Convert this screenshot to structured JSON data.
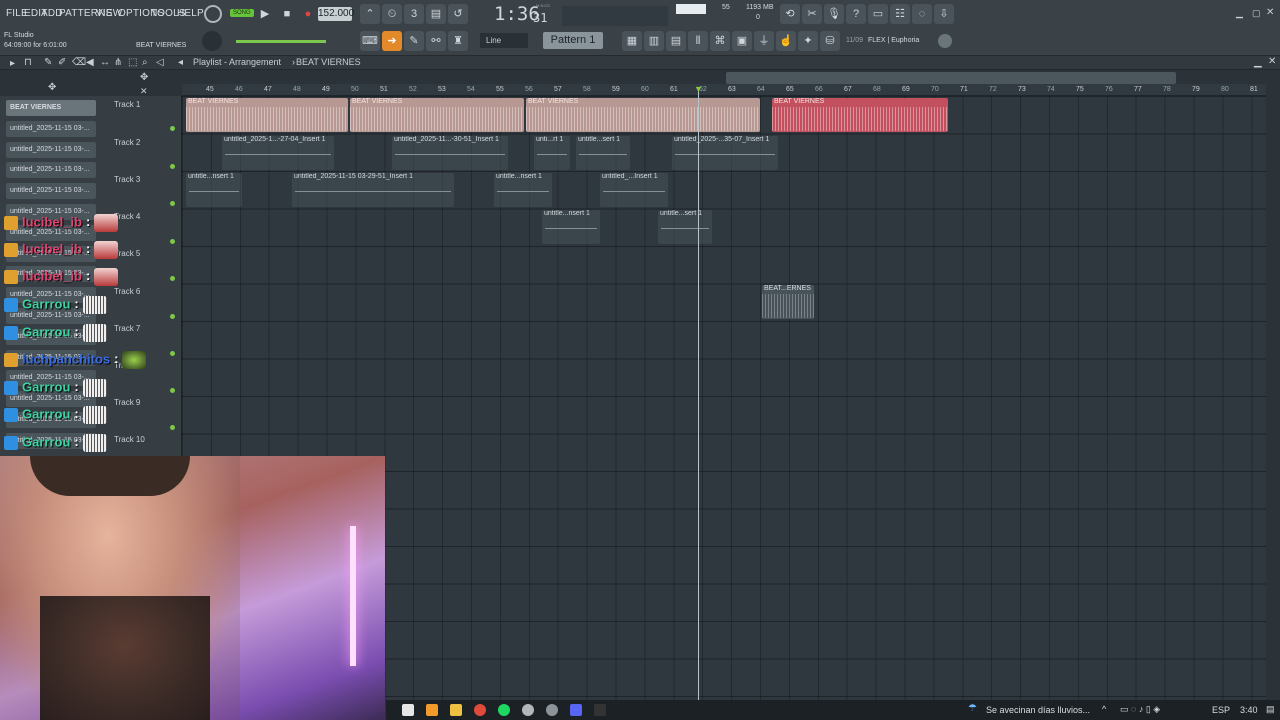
{
  "menu": [
    "FILE",
    "EDIT",
    "ADD",
    "PATTERNS",
    "VIEW",
    "OPTIONS",
    "TOOLS",
    "HELP"
  ],
  "transport": {
    "mode": "SONG",
    "tempo": "152.000",
    "time": "1:36",
    "time_sub": "31",
    "time_unit": "M:S:CS"
  },
  "status": {
    "app": "FL Studio",
    "position": "64:09:00 for 6:01:00",
    "current": "BEAT VIERNES"
  },
  "meters": {
    "cpu": "55",
    "memory": "1193 MB",
    "voices": "0"
  },
  "snap": "Line",
  "pattern": "Pattern 1",
  "news": {
    "date": "11/09",
    "text": "FLEX | Euphoria"
  },
  "playlist": {
    "title": "Playlist - Arrangement",
    "current": "BEAT VIERNES"
  },
  "ruler_ticks": [
    "45",
    "47",
    "49",
    "51",
    "53",
    "55",
    "57",
    "59",
    "61",
    "63",
    "65",
    "67",
    "69",
    "71",
    "73",
    "75",
    "77",
    "79",
    "81",
    "46",
    "48",
    "50",
    "52",
    "54",
    "56",
    "58",
    "60",
    "62",
    "64",
    "66",
    "68",
    "70",
    "72",
    "74",
    "76",
    "78",
    "80"
  ],
  "tracks": [
    "Track 1",
    "Track 2",
    "Track 3",
    "Track 4",
    "Track 5",
    "Track 6",
    "Track 7",
    "Track 8",
    "Track 9",
    "Track 10"
  ],
  "picker": [
    "BEAT VIERNES",
    "untitled_2025-11-15 03-...",
    "untitled_2025-11-15 03-...",
    "untitled_2025-11-15 03-...",
    "untitled_2025-11-15 03-...",
    "untitled_2025-11-15 03-...",
    "untitled_2025-11-15 03-...",
    "untitled_2025-11-15 03-...",
    "untitled_2025-11-15 03-...",
    "untitled_2025-11-15 03-...",
    "untitled_2025-11-15 03-...",
    "untitled_2025-11-15 03-...",
    "untitled_2025-11-15 03-...",
    "untitled_2025-11-15 03-...",
    "untitled_2025-11-15 03-...",
    "untitled_2025-11-15 03-...",
    "untitled_2025-11-15 03-..."
  ],
  "clips": {
    "beat": [
      "BEAT VIERNES",
      "BEAT VIERNES",
      "BEAT VIERNES",
      "BEAT VIERNES"
    ],
    "t2": [
      "untitled_2025-1...-27-04_Insert 1",
      "untitled_2025-11...-30-51_Insert 1",
      "unti...rt 1",
      "untitle...sert 1",
      "untitled_2025-...35-07_Insert 1"
    ],
    "t3": [
      "untitle...nsert 1",
      "untitled_2025-11-15 03-29-51_Insert 1",
      "untitle...nsert 1",
      "untitled_...Insert 1"
    ],
    "t4": [
      "untitle...nsert 1",
      "untitle...sert 1"
    ],
    "t6": [
      "BEAT...ERNES"
    ]
  },
  "chat": [
    {
      "user": "lucibel_ib",
      "text": ":"
    },
    {
      "user": "lucibel_ib",
      "text": ":"
    },
    {
      "user": "lucibel_ib",
      "text": ":"
    },
    {
      "user": "Garrrou",
      "text": ":"
    },
    {
      "user": "Garrrou",
      "text": ":"
    },
    {
      "user": "luchpanchitos",
      "text": ":"
    },
    {
      "user": "Garrrou",
      "text": ":"
    },
    {
      "user": "Garrrou",
      "text": ":"
    },
    {
      "user": "Garrrou",
      "text": ":"
    }
  ],
  "taskbar": {
    "weather": "Se avecinan días lluvios...",
    "lang": "ESP",
    "clock": "3:40"
  },
  "colors": {
    "accent": "#7bc84c",
    "beat_clip": "#b89892",
    "beat_clip_selected": "#c2505e",
    "chat_pink": "#e04470",
    "chat_green": "#3ed1a0",
    "chat_blue": "#3a6ee0"
  }
}
